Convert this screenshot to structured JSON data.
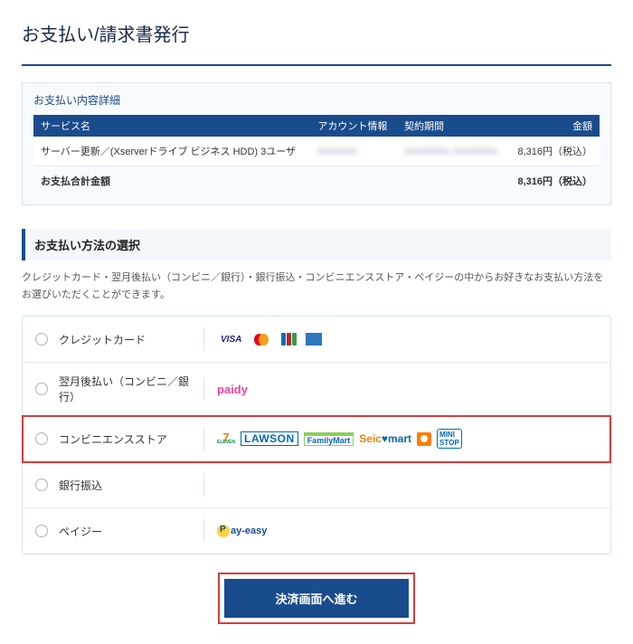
{
  "page_title": "お支払い/請求書発行",
  "detail": {
    "heading": "お支払い内容詳細",
    "columns": [
      "サービス名",
      "アカウント情報",
      "契約期間",
      "金額"
    ],
    "rows": [
      {
        "service": "サーバー更新／(Xserverドライブ ビジネス HDD) 3ユーザ",
        "account": "xxxxxxxx",
        "term": "xxxx/xx/xx  xxxx/xx/xx",
        "amount": "8,316円（税込）"
      }
    ],
    "total_label": "お支払合計金額",
    "total_amount": "8,316円（税込）"
  },
  "method": {
    "heading": "お支払い方法の選択",
    "desc": "クレジットカード・翌月後払い（コンビニ／銀行）・銀行振込・コンビニエンスストア・ペイジーの中からお好きなお支払い方法をお選びいただくことができます。",
    "options": {
      "credit": "クレジットカード",
      "deferred": "翌月後払い（コンビニ／銀行）",
      "cvs": "コンビニエンスストア",
      "bank": "銀行振込",
      "payeasy": "ペイジー"
    }
  },
  "submit_label": "決済画面へ進む"
}
